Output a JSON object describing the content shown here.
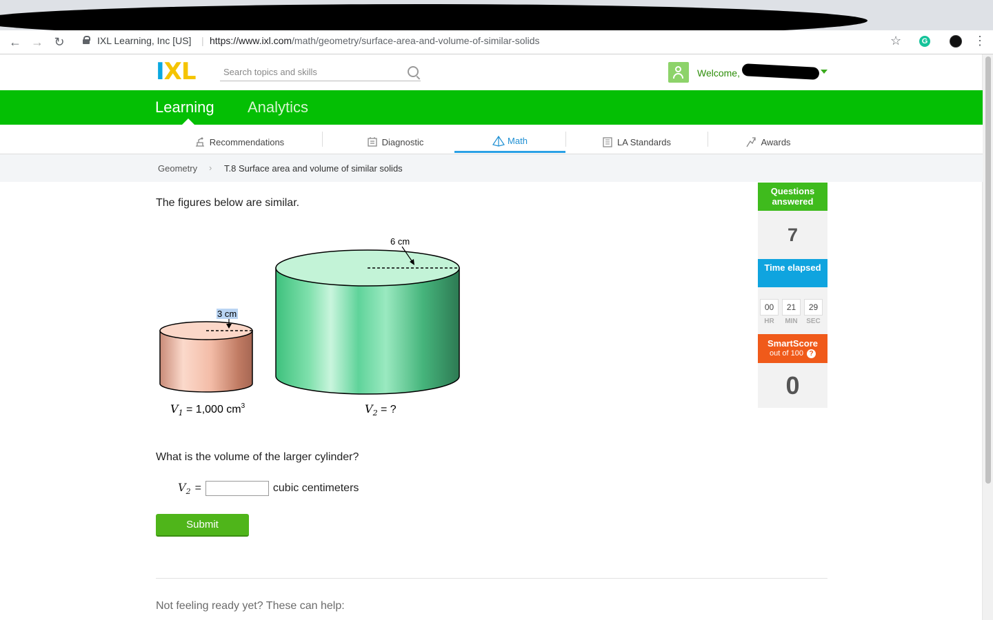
{
  "browser": {
    "site_identity": "IXL Learning, Inc [US]",
    "url_host": "https://www.ixl.com",
    "url_path": "/math/geometry/surface-area-and-volume-of-similar-solids",
    "back_icon": "back-arrow-icon",
    "forward_icon": "forward-arrow-icon",
    "reload_icon": "reload-icon",
    "extension_label": "G"
  },
  "header": {
    "logo": {
      "i": "I",
      "x": "X",
      "l": "L"
    },
    "search_placeholder": "Search topics and skills",
    "welcome": "Welcome,"
  },
  "main_nav": {
    "tabs": [
      {
        "label": "Learning"
      },
      {
        "label": "Analytics"
      }
    ]
  },
  "sub_nav": {
    "items": [
      {
        "label": "Recommendations",
        "icon": "recommendations-icon"
      },
      {
        "label": "Diagnostic",
        "icon": "diagnostic-icon"
      },
      {
        "label": "Math",
        "icon": "math-pyramid-icon",
        "active": true
      },
      {
        "label": "LA Standards",
        "icon": "standards-clipboard-icon"
      },
      {
        "label": "Awards",
        "icon": "awards-icon"
      }
    ]
  },
  "breadcrumb": {
    "subject": "Geometry",
    "skill": "T.8 Surface area and volume of similar solids"
  },
  "problem": {
    "prompt": "The figures below are similar.",
    "small_cylinder": {
      "radius_label": "3 cm",
      "volume_var": "V",
      "volume_sub": "1",
      "volume_value": " = 1,000 cm",
      "volume_sup": "3"
    },
    "large_cylinder": {
      "radius_label": "6 cm",
      "volume_var": "V",
      "volume_sub": "2",
      "volume_value": " = ?"
    },
    "question": "What is the volume of the larger cylinder?",
    "answer": {
      "var": "V",
      "sub": "2",
      "equals": "=",
      "value": "",
      "unit": "cubic centimeters"
    },
    "submit_label": "Submit"
  },
  "footer_help": "Not feeling ready yet? These can help:",
  "stats": {
    "questions_answered_label": "Questions answered",
    "questions_answered": "7",
    "time_elapsed_label": "Time elapsed",
    "time": {
      "hr": "00",
      "min": "21",
      "sec": "29"
    },
    "time_units": {
      "hr": "HR",
      "min": "MIN",
      "sec": "SEC"
    },
    "smartscore_label": "SmartScore",
    "smartscore_sub": "out of 100",
    "smartscore_help": "?",
    "smartscore": "0"
  },
  "colors": {
    "ixl_green": "#04bf04",
    "ixl_blue": "#0fa4df",
    "ixl_orange": "#f05a1a",
    "submit_green": "#4fb51a"
  }
}
